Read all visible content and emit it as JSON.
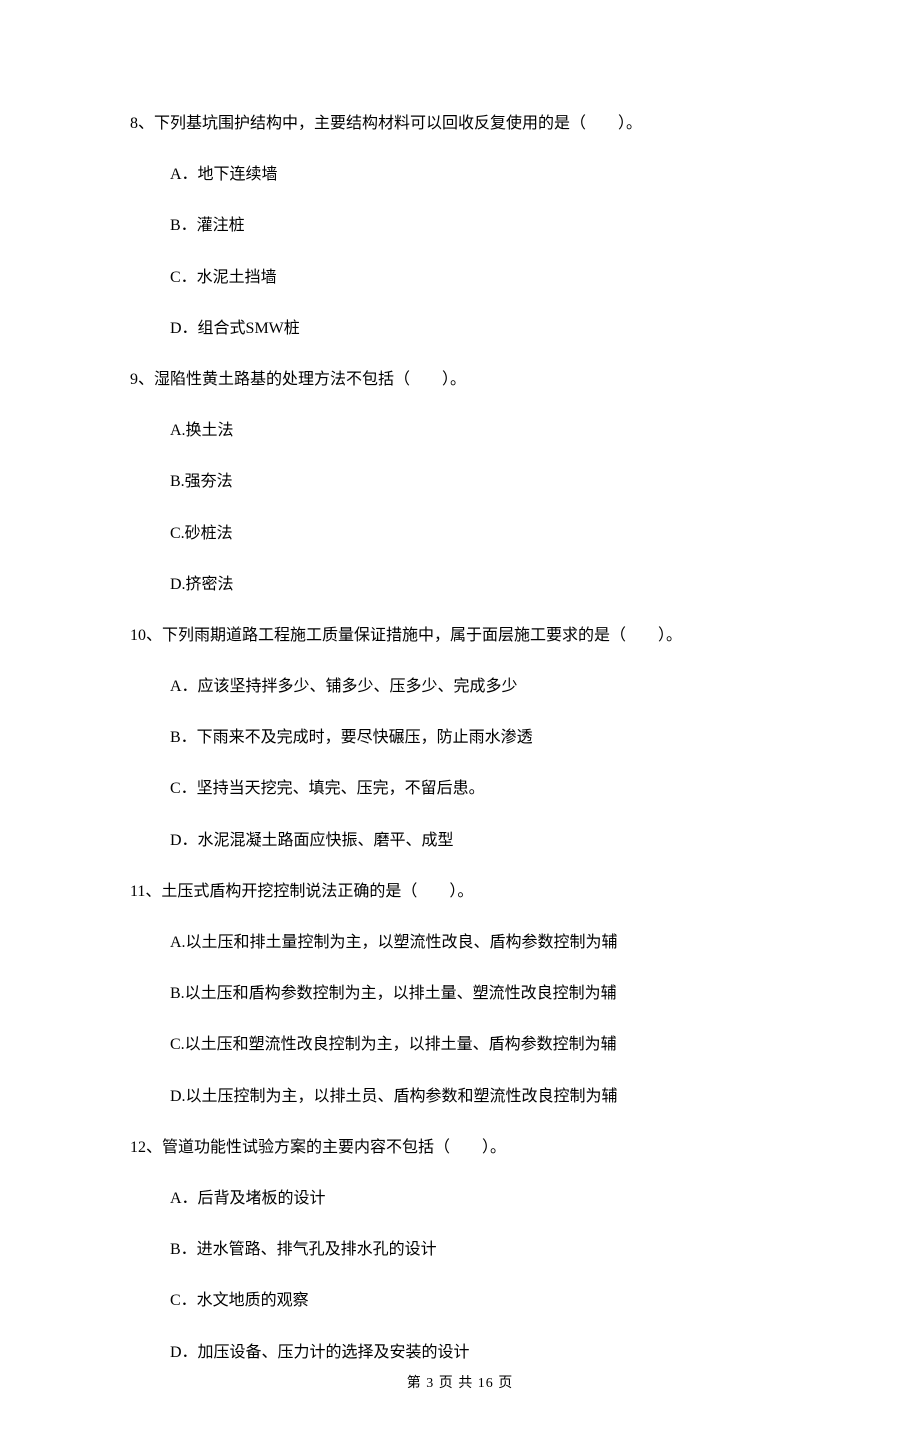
{
  "questions": [
    {
      "number": "8、",
      "stem": "下列基坑围护结构中，主要结构材料可以回收反复使用的是（　　）。",
      "options": [
        "A．地下连续墙",
        "B．灌注桩",
        "C．水泥土挡墙",
        "D．组合式SMW桩"
      ]
    },
    {
      "number": "9、",
      "stem": "湿陷性黄土路基的处理方法不包括（　　）。",
      "options": [
        "A.换土法",
        "B.强夯法",
        "C.砂桩法",
        "D.挤密法"
      ]
    },
    {
      "number": "10、",
      "stem": "下列雨期道路工程施工质量保证措施中，属于面层施工要求的是（　　）。",
      "options": [
        "A．应该坚持拌多少、铺多少、压多少、完成多少",
        "B．下雨来不及完成时，要尽快碾压，防止雨水渗透",
        "C．坚持当天挖完、填完、压完，不留后患。",
        "D．水泥混凝土路面应快振、磨平、成型"
      ]
    },
    {
      "number": "11、",
      "stem": "土压式盾构开挖控制说法正确的是（　　）。",
      "options": [
        "A.以土压和排土量控制为主，以塑流性改良、盾构参数控制为辅",
        "B.以土压和盾构参数控制为主，以排土量、塑流性改良控制为辅",
        "C.以土压和塑流性改良控制为主，以排土量、盾构参数控制为辅",
        "D.以土压控制为主，以排土员、盾构参数和塑流性改良控制为辅"
      ]
    },
    {
      "number": "12、",
      "stem": "管道功能性试验方案的主要内容不包括（　　）。",
      "options": [
        "A．后背及堵板的设计",
        "B．进水管路、排气孔及排水孔的设计",
        "C．水文地质的观察",
        "D．加压设备、压力计的选择及安装的设计"
      ]
    }
  ],
  "footer": "第 3 页 共 16 页"
}
